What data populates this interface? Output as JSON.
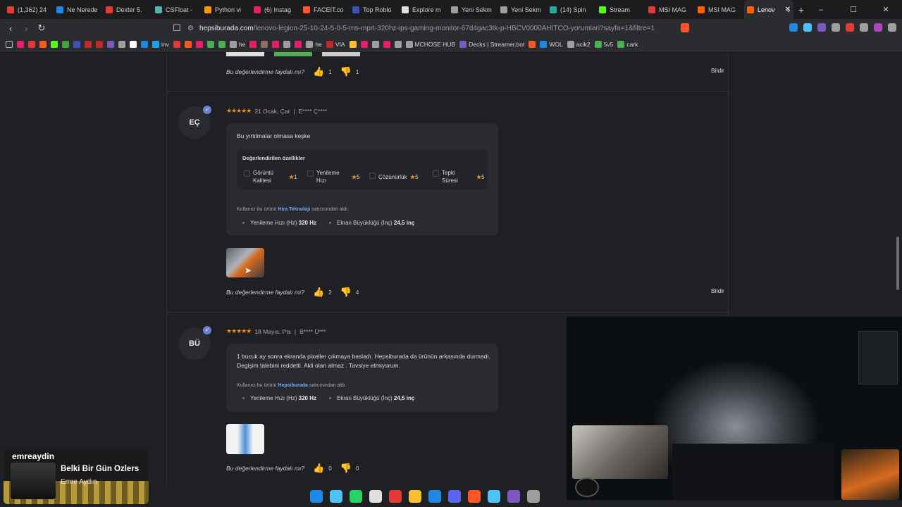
{
  "tabs": [
    {
      "label": "(1,362) 24",
      "color": "#e53935"
    },
    {
      "label": "Ne Nerede",
      "color": "#1e88e5"
    },
    {
      "label": "Dexter 5.",
      "color": "#e53935"
    },
    {
      "label": "CSFloat - ",
      "color": "#4db6ac"
    },
    {
      "label": "Python vi",
      "color": "#ff9800"
    },
    {
      "label": "(6) Instag",
      "color": "#e91e63"
    },
    {
      "label": "FACEIT.co",
      "color": "#ff5722"
    },
    {
      "label": "Top Roblo",
      "color": "#3f51b5"
    },
    {
      "label": "Explore m",
      "color": "#e0e0e0"
    },
    {
      "label": "Yeni Sekm",
      "color": "#9e9e9e"
    },
    {
      "label": "Yeni Sekm",
      "color": "#9e9e9e"
    },
    {
      "label": "(14) Spin",
      "color": "#26a69a"
    },
    {
      "label": "Stream",
      "color": "#53fc18"
    },
    {
      "label": "MSI MAG",
      "color": "#e53935"
    },
    {
      "label": "MSI MAG",
      "color": "#ff6000"
    },
    {
      "label": "Lenov",
      "color": "#ff6000",
      "active": true
    }
  ],
  "window_controls": {
    "minimize": "–",
    "maximize": "☐",
    "close": "✕",
    "dropdown": "⌄"
  },
  "new_tab": "+",
  "address": {
    "domain": "hepsiburada.com",
    "path": "/lenovo-legion-25-10-24-5-0-5-ms-mprt-320hz-ips-gaming-monitor-67d4gac3tk-p-HBCV0000AHITCO-yorumlari?sayfa=1&filtre=1"
  },
  "bookmarks": [
    {
      "label": "",
      "color": "#e91e63"
    },
    {
      "label": "",
      "color": "#e53935"
    },
    {
      "label": "",
      "color": "#ff5722"
    },
    {
      "label": "",
      "color": "#53fc18"
    },
    {
      "label": "",
      "color": "#43a047"
    },
    {
      "label": "",
      "color": "#3f51b5"
    },
    {
      "label": "",
      "color": "#c62828"
    },
    {
      "label": "",
      "color": "#c62828"
    },
    {
      "label": "",
      "color": "#7e57c2"
    },
    {
      "label": "",
      "color": "#9e9e9e"
    },
    {
      "label": "",
      "color": "#ffffff"
    },
    {
      "label": "",
      "color": "#1e88e5"
    },
    {
      "label": "inv",
      "color": "#1da1f2"
    },
    {
      "label": "",
      "color": "#e53935"
    },
    {
      "label": "",
      "color": "#ff5722"
    },
    {
      "label": "",
      "color": "#e91e63"
    },
    {
      "label": "",
      "color": "#4caf50"
    },
    {
      "label": "",
      "color": "#4caf50"
    },
    {
      "label": "he",
      "color": "#9e9e9e"
    },
    {
      "label": "",
      "color": "#e91e63"
    },
    {
      "label": "",
      "color": "#8d6e63"
    },
    {
      "label": "",
      "color": "#e91e63"
    },
    {
      "label": "",
      "color": "#9e9e9e"
    },
    {
      "label": "",
      "color": "#e91e63"
    },
    {
      "label": "he",
      "color": "#9e9e9e"
    },
    {
      "label": "VIA",
      "color": "#c62828"
    },
    {
      "label": "",
      "color": "#fbc02d"
    },
    {
      "label": "",
      "color": "#e91e63"
    },
    {
      "label": "",
      "color": "#9e9e9e"
    },
    {
      "label": "",
      "color": "#e91e63"
    },
    {
      "label": "",
      "color": "#9e9e9e"
    },
    {
      "label": "MCHOSE HUB",
      "color": "#9e9e9e"
    },
    {
      "label": "Decks | Streamer.bot",
      "color": "#7e57c2"
    },
    {
      "label": "",
      "color": "#ff5722"
    },
    {
      "label": "WOL",
      "color": "#1e88e5"
    },
    {
      "label": "acik2",
      "color": "#9e9e9e"
    },
    {
      "label": "5v5",
      "color": "#4caf50"
    },
    {
      "label": "cark",
      "color": "#4caf50"
    }
  ],
  "helpful_question": "Bu değerlendirme faydalı mı?",
  "report_label": "Bildir",
  "top_review": {
    "likes": "1",
    "dislikes": "1"
  },
  "review1": {
    "initials": "EÇ",
    "stars": "★★★★★",
    "date": "21 Ocak, Çar",
    "author": "E**** Ç****",
    "text": "Bu yırtılmalar olmasa keşke",
    "features_title": "Değerlendirilen özellikler",
    "features": [
      {
        "name": "Görüntü Kalitesi",
        "score": "1"
      },
      {
        "name": "Yenileme Hızı",
        "score": "5"
      },
      {
        "name": "Çözünürlük",
        "score": "5"
      },
      {
        "name": "Tepki Süresi",
        "score": "5"
      }
    ],
    "seller_prefix": "Kullanıcı bu ürünü",
    "seller": "Hira Teknoloji",
    "seller_suffix": "satıcısından aldı.",
    "spec1_label": "Yenileme Hızı (Hz)",
    "spec1_value": "320 Hz",
    "spec2_label": "Ekran Büyüklüğü (İnç)",
    "spec2_value": "24,5 inç",
    "likes": "2",
    "dislikes": "4"
  },
  "review2": {
    "initials": "BÜ",
    "stars": "★★★★★",
    "date": "18 Mayıs, Pts",
    "author": "B**** Ü***",
    "text": "1 bucuk ay sonra ekranda pixeller çıkmaya basladı. Hepsiburada da ürünün arkasında durmadı. Degişim talebini reddetti. Akli olan almaz . Tavsiye etmiyorum.",
    "seller_prefix": "Kullanıcı bu ürünü",
    "seller": "Hepsiburada",
    "seller_suffix": "satıcısından aldı.",
    "spec1_label": "Yenileme Hızı (Hz)",
    "spec1_value": "320 Hz",
    "spec2_label": "Ekran Büyüklüğü (İnç)",
    "spec2_value": "24,5 inç",
    "likes": "0",
    "dislikes": "0"
  },
  "music": {
    "logo": "emreaydin",
    "title": "Belki Bir Gün Özlers",
    "artist": "Emre Aydın"
  },
  "taskbar_colors": [
    "#1e88e5",
    "#4fc3f7",
    "#25d366",
    "#e0e0e0",
    "#e53935",
    "#fbc02d",
    "#1e88e5",
    "#5865f2",
    "#ff5722",
    "#4fc3f7",
    "#7e57c2",
    "#9e9e9e"
  ]
}
